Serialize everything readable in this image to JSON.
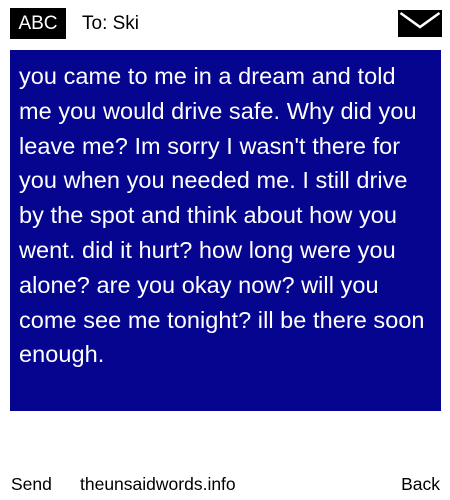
{
  "header": {
    "mode_label": "ABC",
    "recipient_label": "To: Ski",
    "mail_icon": "envelope-icon"
  },
  "message": {
    "body": "you came to me in a dream and told me you would drive safe. Why did you leave me? Im sorry I wasn't there for you when you needed me. I still drive by the spot and think about how you went. did it hurt? how long were you alone? are you okay now? will you come see me tonight? ill be there soon enough."
  },
  "footer": {
    "send_label": "Send",
    "site_label": "theunsaidwords.info",
    "back_label": "Back"
  },
  "colors": {
    "message_background": "#05058f",
    "message_text": "#ffffff",
    "badge_background": "#000000"
  }
}
